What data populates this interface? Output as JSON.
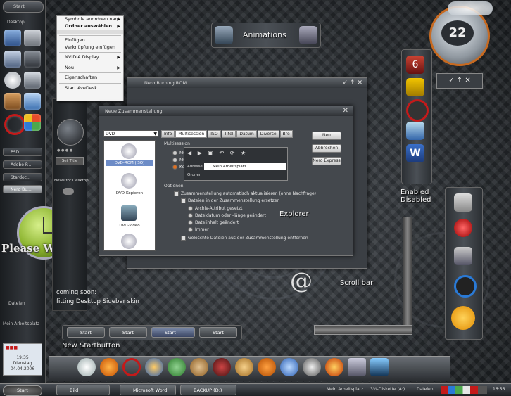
{
  "desktop": {
    "annotations": {
      "animations": "Animations",
      "enabled": "Enabled",
      "disabled": "Disabled",
      "explorer": "Explorer",
      "scroll_bar": "Scroll bar",
      "coming_soon_1": "coming soon:",
      "coming_soon_2": "fitting Desktop Sidebar skin",
      "new_startbutton": "New Startbutton",
      "please_wait": "Please Wait",
      "at_sign": "@"
    },
    "clock_widget": {
      "value": "22"
    },
    "side_panel_digit": "6"
  },
  "context_menu": {
    "items": [
      {
        "label": "Symbole anordnen nach",
        "submenu": true,
        "bold": false
      },
      {
        "label": "Ordner auswählen",
        "submenu": true,
        "bold": true
      },
      {
        "label": "Einfügen",
        "submenu": false,
        "bold": false
      },
      {
        "label": "Verknüpfung einfügen",
        "submenu": false,
        "bold": false
      },
      {
        "label": "NVIDIA Display",
        "submenu": true,
        "bold": false
      },
      {
        "label": "Neu",
        "submenu": true,
        "bold": false
      },
      {
        "label": "Eigenschaften",
        "submenu": false,
        "bold": false
      },
      {
        "label": "Start AveDesk",
        "submenu": false,
        "bold": false
      }
    ]
  },
  "sidebar": {
    "top_label": "Desktop",
    "tasks": [
      "PSD",
      "Adobe P...",
      "Stardoc...",
      "Nero Bu..."
    ],
    "bottom_items": [
      "Dateien",
      "Mein Arbeitsplatz"
    ],
    "clock": {
      "time": "19:35",
      "day": "Dienstag",
      "date": "04.04.2006"
    },
    "start_label": "Start"
  },
  "gadget": {
    "button_label": "Set Title",
    "news_label": "News for Desktop"
  },
  "nero_window": {
    "title": "Nero Burning ROM"
  },
  "dialog": {
    "title": "Neue Zusammenstellung",
    "disc_type": "DVD",
    "list_items": [
      "DVD-ROM (ISO)",
      "DVD-Kopieren",
      "DVD-Video"
    ],
    "tabs": [
      "Info",
      "Multisession",
      "ISO",
      "Titel",
      "Datum",
      "Diverse",
      "Bre"
    ],
    "active_tab": "Multisession",
    "group_multisession": "Multisession",
    "radio_labels": [
      "Mu",
      "Mu",
      "Ko"
    ],
    "address_label": "Adresse",
    "folder_label": "Ordner",
    "address_value": "Mein Arbeitsplatz",
    "group_options": "Optionen",
    "options": [
      {
        "text": "Zusammenstellung automatisch aktualisieren (ohne Nachfrage)",
        "indent": 0,
        "kind": "check"
      },
      {
        "text": "Dateien in der Zusammenstellung ersetzen",
        "indent": 1,
        "kind": "check"
      },
      {
        "text": "Archiv-Attribut gesetzt",
        "indent": 2,
        "kind": "radio"
      },
      {
        "text": "Dateidatum oder -länge geändert",
        "indent": 2,
        "kind": "radio"
      },
      {
        "text": "Dateiinhalt geändert",
        "indent": 2,
        "kind": "radio"
      },
      {
        "text": "Immer",
        "indent": 2,
        "kind": "radio"
      },
      {
        "text": "Gelöschte Dateien aus der Zusammenstellung entfernen",
        "indent": 1,
        "kind": "check"
      }
    ],
    "buttons": [
      "Neu",
      "Abbrechen",
      "Nero Express"
    ]
  },
  "start_strip": {
    "labels": [
      "Start",
      "Start",
      "Start",
      "Start"
    ]
  },
  "taskbar": {
    "start_label": "Start",
    "buttons": [
      "Bild",
      "Microsoft Word",
      "BACKUP (D:)"
    ],
    "tray_items": [
      "Mein Arbeitsplatz",
      "3½-Diskette (A:)",
      "Dateien"
    ],
    "clock": "16:56"
  },
  "colors": {
    "accent": "#e07020",
    "red_ring": "#c41a1a",
    "clock_green": "#9ac23a"
  }
}
